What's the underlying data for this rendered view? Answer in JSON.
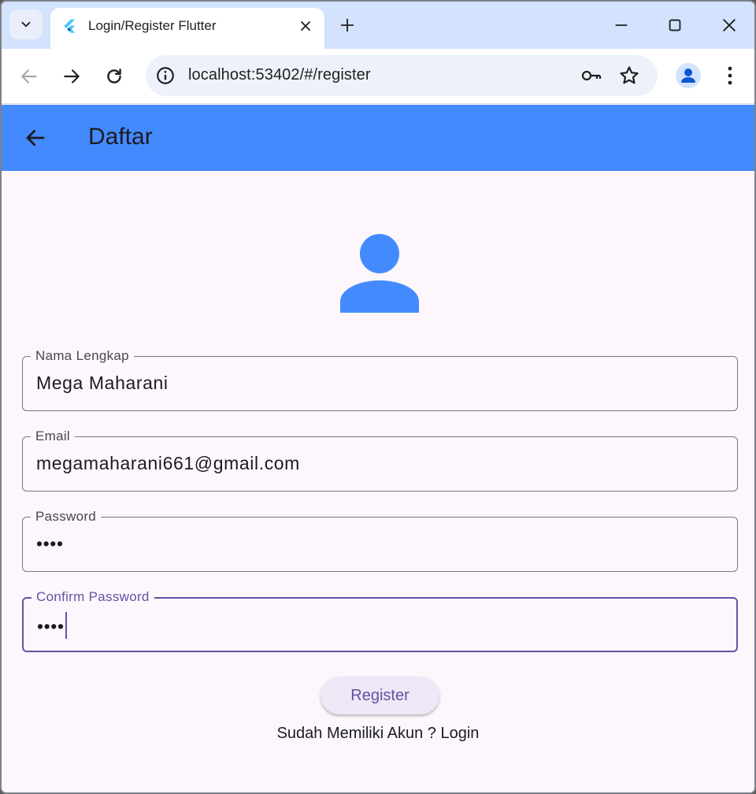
{
  "browser": {
    "tab_title": "Login/Register Flutter",
    "url": "localhost:53402/#/register"
  },
  "appbar": {
    "title": "Daftar",
    "color": "#448aff"
  },
  "form": {
    "full_name": {
      "label": "Nama Lengkap",
      "value": "Mega Maharani"
    },
    "email": {
      "label": "Email",
      "value": "megamaharani661@gmail.com"
    },
    "password": {
      "label": "Password",
      "value": "••••"
    },
    "confirm_password": {
      "label": "Confirm Password",
      "value": "••••"
    }
  },
  "register_label": "Register",
  "login_prompt": "Sudah Memiliki Akun ? Login",
  "colors": {
    "primary": "#6750a4",
    "page_bg": "#fdf7fd",
    "icon_blue": "#448aff"
  }
}
